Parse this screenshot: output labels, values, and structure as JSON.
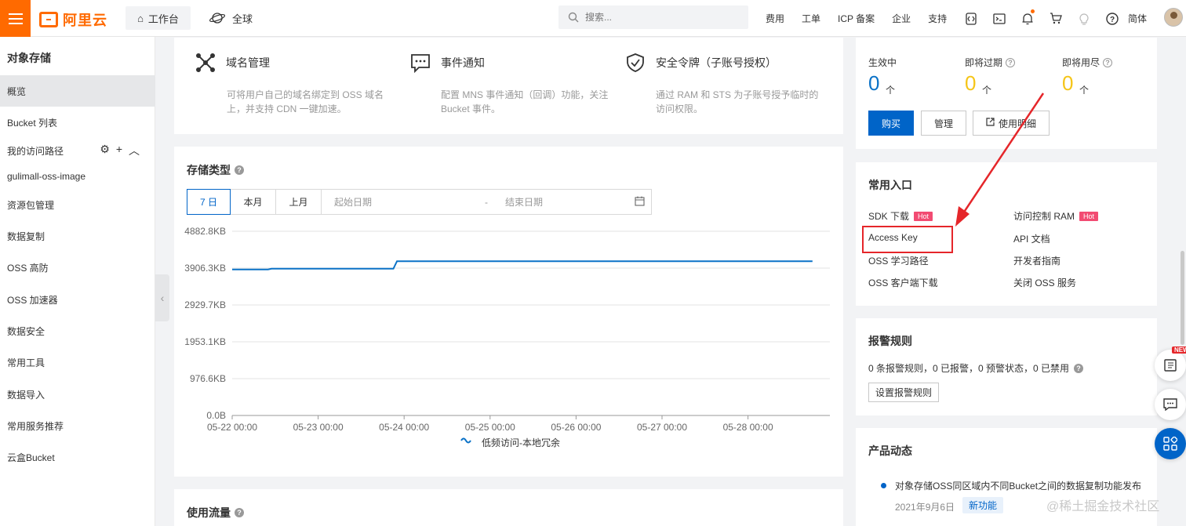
{
  "topbar": {
    "logo_text": "阿里云",
    "workbench_label": "工作台",
    "region_label": "全球",
    "search_placeholder": "搜索...",
    "nav": [
      "费用",
      "工单",
      "ICP 备案",
      "企业",
      "支持"
    ],
    "icons": [
      "code-icon",
      "terminal-icon",
      "bell-icon",
      "cart-icon",
      "bulb-icon",
      "help-icon"
    ],
    "language": "简体"
  },
  "sidebar": {
    "title": "对象存储",
    "items": [
      {
        "label": "概览",
        "active": true
      },
      {
        "label": "Bucket 列表"
      },
      {
        "label": "我的访问路径"
      },
      {
        "label": "gulimall-oss-image"
      },
      {
        "label": "资源包管理"
      },
      {
        "label": "数据复制"
      },
      {
        "label": "OSS 高防"
      },
      {
        "label": "OSS 加速器"
      },
      {
        "label": "数据安全"
      },
      {
        "label": "常用工具"
      },
      {
        "label": "数据导入"
      },
      {
        "label": "常用服务推荐"
      },
      {
        "label": "云盒Bucket"
      }
    ]
  },
  "features": [
    {
      "title": "域名管理",
      "desc": "可将用户自己的域名绑定到 OSS 域名上，并支持 CDN 一键加速。",
      "icon": "network-icon"
    },
    {
      "title": "事件通知",
      "desc": "配置 MNS 事件通知（回调）功能，关注 Bucket 事件。",
      "icon": "message-icon"
    },
    {
      "title": "安全令牌（子账号授权）",
      "desc": "通过 RAM 和 STS 为子账号授予临时的访问权限。",
      "icon": "shield-check-icon"
    }
  ],
  "storage": {
    "title": "存储类型",
    "tabs": [
      "7 日",
      "本月",
      "上月"
    ],
    "start_placeholder": "起始日期",
    "separator": "-",
    "end_placeholder": "结束日期"
  },
  "usage": {
    "title": "使用流量"
  },
  "chart_data": {
    "type": "line",
    "title": "",
    "xlabel": "",
    "ylabel": "",
    "yticks": [
      "0.0B",
      "976.6KB",
      "1953.1KB",
      "2929.7KB",
      "3906.3KB",
      "4882.8KB"
    ],
    "ylim": [
      0,
      4882.8
    ],
    "yunit": "KB",
    "xticks": [
      "05-22 00:00",
      "05-23 00:00",
      "05-24 00:00",
      "05-25 00:00",
      "05-26 00:00",
      "05-27 00:00",
      "05-28 00:00"
    ],
    "series": [
      {
        "name": "低频访问-本地冗余",
        "color": "#0b72c7",
        "x": [
          "05-22 00:00",
          "05-22 10:00",
          "05-22 11:00",
          "05-23 00:00",
          "05-23 12:00",
          "05-23 21:00",
          "05-23 22:00",
          "05-24 00:00",
          "05-25 00:00",
          "05-26 00:00",
          "05-27 00:00",
          "05-28 00:00",
          "05-28 18:00"
        ],
        "values": [
          3870,
          3870,
          3890,
          3890,
          3890,
          3890,
          4090,
          4090,
          4090,
          4090,
          4090,
          4090,
          4090
        ]
      }
    ],
    "legend": "bottom",
    "grid": true
  },
  "resource": {
    "labels": [
      "生效中",
      "即将过期",
      "即将用尽"
    ],
    "counts": [
      "0",
      "0",
      "0"
    ],
    "count_colors": [
      "#0b72c7",
      "#f5c518",
      "#f5c518"
    ],
    "unit": "个",
    "buttons": {
      "buy": "购买",
      "manage": "管理",
      "detail": "使用明细"
    }
  },
  "entries": {
    "title": "常用入口",
    "left": [
      {
        "label": "SDK 下载",
        "hot": "Hot"
      },
      {
        "label": "Access Key"
      },
      {
        "label": "OSS 学习路径"
      },
      {
        "label": "OSS 客户端下载"
      }
    ],
    "right": [
      {
        "label": "访问控制 RAM",
        "hot": "Hot"
      },
      {
        "label": "API 文档"
      },
      {
        "label": "开发者指南"
      },
      {
        "label": "关闭 OSS 服务"
      }
    ]
  },
  "alarm": {
    "title": "报警规则",
    "summary": "0 条报警规则，0 已报警，0 预警状态，0 已禁用",
    "button": "设置报警规则"
  },
  "news": {
    "title": "产品动态",
    "item": "对象存储OSS同区域内不同Bucket之间的数据复制功能发布",
    "date": "2021年9月6日",
    "tag": "新功能"
  },
  "floating": {
    "new_tag": "NEW"
  },
  "watermark": "@稀土掘金技术社区"
}
